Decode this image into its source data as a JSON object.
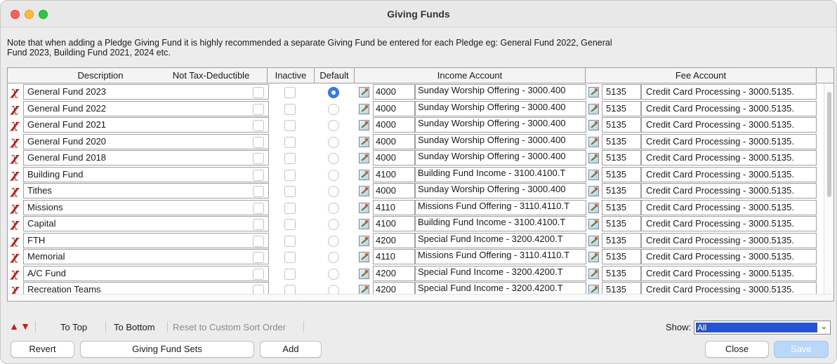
{
  "window": {
    "title": "Giving Funds",
    "colors": {
      "close": "#fe5f57",
      "minimize": "#febc2e",
      "maximize": "#28c840"
    }
  },
  "note": "Note that when adding a Pledge Giving Fund it is highly recommended a separate Giving Fund be entered for each Pledge eg: General Fund 2022, General Fund 2023, Building Fund 2021, 2024 etc.",
  "table": {
    "columns": {
      "description": "Description",
      "not_tax_deductible": "Not Tax-Deductible",
      "inactive": "Inactive",
      "default": "Default",
      "income_account": "Income Account",
      "fee_account": "Fee Account"
    },
    "rows": [
      {
        "description": "General Fund 2023",
        "not_tax_deductible": false,
        "inactive": false,
        "default": true,
        "income_num": "4000",
        "income_name": "Sunday Worship Offering - 3000.400",
        "fee_num": "5135",
        "fee_name": "Credit Card Processing - 3000.5135."
      },
      {
        "description": "General Fund 2022",
        "not_tax_deductible": false,
        "inactive": false,
        "default": false,
        "income_num": "4000",
        "income_name": "Sunday Worship Offering - 3000.400",
        "fee_num": "5135",
        "fee_name": "Credit Card Processing - 3000.5135."
      },
      {
        "description": "General Fund 2021",
        "not_tax_deductible": false,
        "inactive": false,
        "default": false,
        "income_num": "4000",
        "income_name": "Sunday Worship Offering - 3000.400",
        "fee_num": "5135",
        "fee_name": "Credit Card Processing - 3000.5135."
      },
      {
        "description": "General Fund 2020",
        "not_tax_deductible": false,
        "inactive": false,
        "default": false,
        "income_num": "4000",
        "income_name": "Sunday Worship Offering - 3000.400",
        "fee_num": "5135",
        "fee_name": "Credit Card Processing - 3000.5135."
      },
      {
        "description": "General Fund 2018",
        "not_tax_deductible": false,
        "inactive": false,
        "default": false,
        "income_num": "4000",
        "income_name": "Sunday Worship Offering - 3000.400",
        "fee_num": "5135",
        "fee_name": "Credit Card Processing - 3000.5135."
      },
      {
        "description": "Building Fund",
        "not_tax_deductible": false,
        "inactive": false,
        "default": false,
        "income_num": "4100",
        "income_name": "Building Fund Income - 3100.4100.T",
        "fee_num": "5135",
        "fee_name": "Credit Card Processing - 3000.5135."
      },
      {
        "description": "Tithes",
        "not_tax_deductible": false,
        "inactive": false,
        "default": false,
        "income_num": "4000",
        "income_name": "Sunday Worship Offering - 3000.400",
        "fee_num": "5135",
        "fee_name": "Credit Card Processing - 3000.5135."
      },
      {
        "description": "Missions",
        "not_tax_deductible": false,
        "inactive": false,
        "default": false,
        "income_num": "4110",
        "income_name": "Missions Fund Offering - 3110.4110.T",
        "fee_num": "5135",
        "fee_name": "Credit Card Processing - 3000.5135."
      },
      {
        "description": "Capital",
        "not_tax_deductible": false,
        "inactive": false,
        "default": false,
        "income_num": "4100",
        "income_name": "Building Fund Income - 3100.4100.T",
        "fee_num": "5135",
        "fee_name": "Credit Card Processing - 3000.5135."
      },
      {
        "description": "FTH",
        "not_tax_deductible": false,
        "inactive": false,
        "default": false,
        "income_num": "4200",
        "income_name": "Special Fund Income - 3200.4200.T",
        "fee_num": "5135",
        "fee_name": "Credit Card Processing - 3000.5135."
      },
      {
        "description": "Memorial",
        "not_tax_deductible": false,
        "inactive": false,
        "default": false,
        "income_num": "4110",
        "income_name": "Missions Fund Offering - 3110.4110.T",
        "fee_num": "5135",
        "fee_name": "Credit Card Processing - 3000.5135."
      },
      {
        "description": "A/C Fund",
        "not_tax_deductible": false,
        "inactive": false,
        "default": false,
        "income_num": "4200",
        "income_name": "Special Fund Income - 3200.4200.T",
        "fee_num": "5135",
        "fee_name": "Credit Card Processing - 3000.5135."
      },
      {
        "description": "Recreation Teams",
        "not_tax_deductible": false,
        "inactive": false,
        "default": false,
        "income_num": "4200",
        "income_name": "Special Fund Income - 3200.4200.T",
        "fee_num": "5135",
        "fee_name": "Credit Card Processing - 3000.5135."
      }
    ]
  },
  "sort_bar": {
    "to_top": "To Top",
    "to_bottom": "To Bottom",
    "reset": "Reset to Custom Sort Order",
    "up_icon": "up-arrow-icon",
    "down_icon": "down-arrow-icon"
  },
  "show": {
    "label": "Show:",
    "value": "All"
  },
  "buttons": {
    "revert": "Revert",
    "giving_fund_sets": "Giving Fund Sets",
    "add": "Add",
    "close": "Close",
    "save": "Save"
  }
}
